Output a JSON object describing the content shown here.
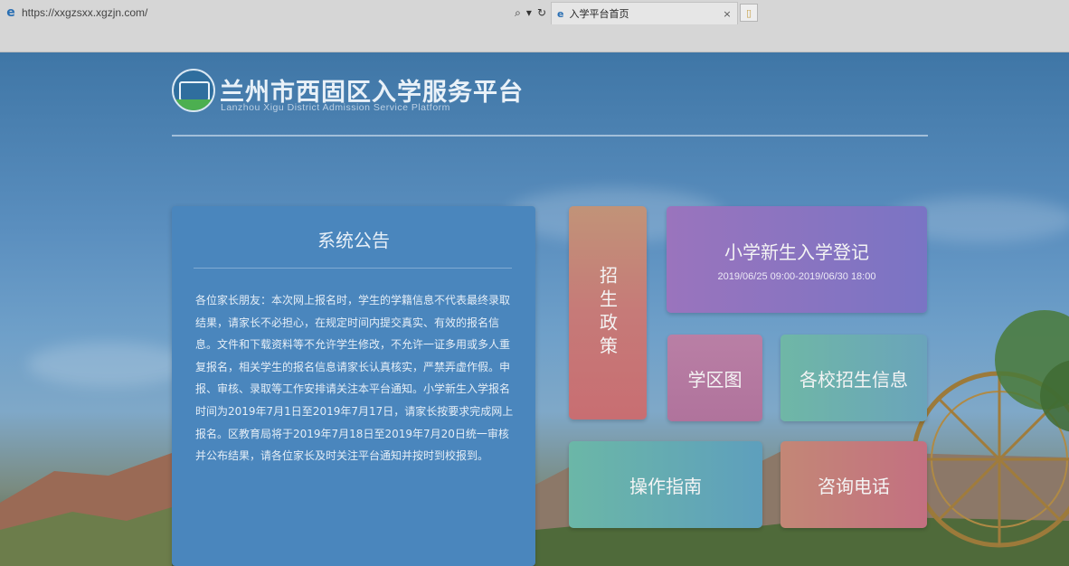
{
  "browser": {
    "url": "https://xxgzsxx.xgzjn.com/",
    "tab_title": "入学平台首页",
    "search_glyph": "⌕",
    "dropdown_glyph": "▾",
    "refresh_glyph": "↻",
    "close_glyph": "×",
    "ie_glyph": "e",
    "new_tab_glyph": "▯"
  },
  "header": {
    "title": "兰州市西固区入学服务平台",
    "subtitle": "Lanzhou Xigu District Admission Service Platform"
  },
  "notice": {
    "title": "系统公告",
    "paragraphs": [
      "各位家长朋友：本次网上报名时，学生的学籍信息不代表最终录取结果，请家长不必担心，在规定时间内提交真实、有效的报名信息。文件和下载资料等不允许学生修改，不允许一证多用或多人重复报名，相关学生的报名信息请家长认真核实，严禁弄虚作假。申报、审核、录取等工作安排请关注本平台通知。小学新生入学报名时间为2019年7月1日至2019年7月17日，请家长按要求完成网上报名。区教育局将于2019年7月18日至2019年7月20日统一审核并公布结果，请各位家长及时关注平台通知并按时到校报到。"
    ]
  },
  "tiles": {
    "policy": "招生政策",
    "registration": "小学新生入学登记",
    "registration_time": "2019/06/25 09:00-2019/06/30 18:00",
    "school_map": "学区图",
    "school_info": "各校招生信息",
    "guide": "操作指南",
    "phone": "咨询电话"
  },
  "colors": {
    "notice_bg": "#4a86bd",
    "policy": "#c67a78",
    "registration": "#8a74c1",
    "school_map": "#b57aa1",
    "school_info": "#6aadb2",
    "guide": "#65abb2",
    "phone": "#c37c7b"
  }
}
